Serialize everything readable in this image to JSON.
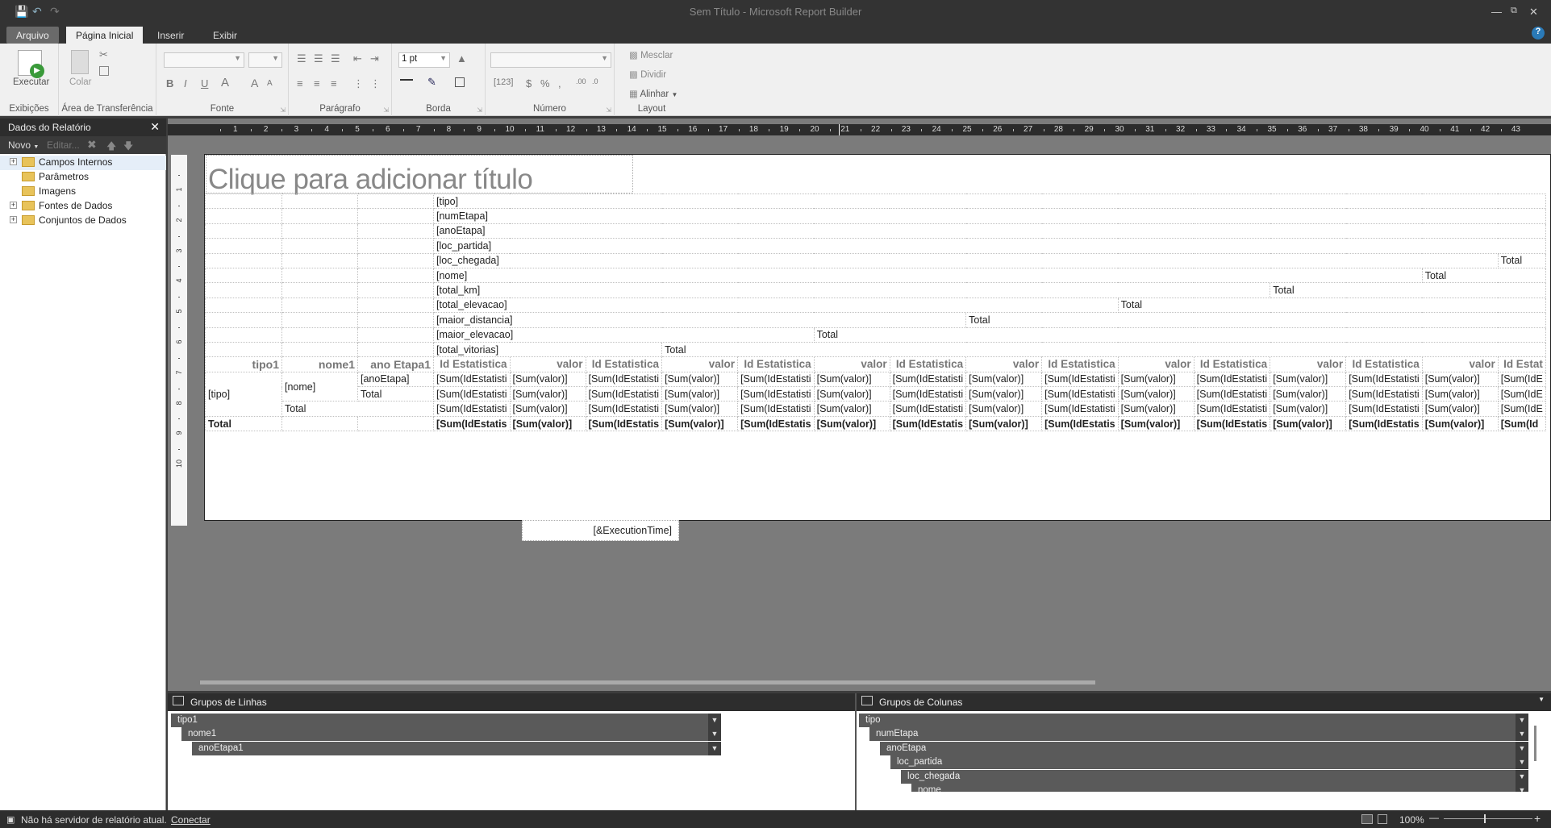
{
  "window": {
    "title": "Sem Título - Microsoft Report Builder"
  },
  "tabs": [
    {
      "label": "Arquivo"
    },
    {
      "label": "Página Inicial"
    },
    {
      "label": "Inserir"
    },
    {
      "label": "Exibir"
    }
  ],
  "ribbon": {
    "groups": {
      "exibicoes": "Exibições",
      "transferencia": "Área de Transferência",
      "fonte": "Fonte",
      "paragrafo": "Parágrafo",
      "borda": "Borda",
      "numero": "Número",
      "layout": "Layout"
    },
    "executar": "Executar",
    "colar": "Colar",
    "border_width": "1 pt",
    "mesclar": "Mesclar",
    "dividir": "Dividir",
    "alinhar": "Alinhar"
  },
  "left_panel": {
    "title": "Dados do Relatório",
    "novo": "Novo",
    "editar": "Editar...",
    "items": [
      {
        "label": "Campos Internos"
      },
      {
        "label": "Parâmetros"
      },
      {
        "label": "Imagens"
      },
      {
        "label": "Fontes de Dados"
      },
      {
        "label": "Conjuntos de Dados"
      }
    ]
  },
  "report": {
    "title_placeholder": "Clique para adicionar título",
    "exec_time": "[&ExecutionTime]",
    "ruler_numbers": [
      "1",
      "2",
      "3",
      "4",
      "5",
      "6",
      "7",
      "8",
      "9",
      "10",
      "11",
      "12",
      "13",
      "14",
      "15",
      "16",
      "17",
      "18",
      "19",
      "20",
      "21",
      "22",
      "23",
      "24",
      "25",
      "26",
      "27",
      "28",
      "29",
      "30",
      "31",
      "32",
      "33",
      "34",
      "35",
      "36",
      "37",
      "38",
      "39",
      "40",
      "41",
      "42",
      "43"
    ],
    "vruler_numbers": [
      "1",
      "2",
      "3",
      "4",
      "5",
      "6",
      "7",
      "8",
      "9",
      "10"
    ],
    "col_groups": [
      "[tipo]",
      "[numEtapa]",
      "[anoEtapa]",
      "[loc_partida]",
      "[loc_chegada]",
      "[nome]",
      "[total_km]",
      "[total_elevacao]",
      "[maior_distancia]",
      "[maior_elevacao]",
      "[total_vitorias]"
    ],
    "total": "Total",
    "row_headers": [
      "tipo1",
      "nome1",
      "ano Etapa1"
    ],
    "col_header_id": "Id Estatistica",
    "col_header_val": "valor",
    "cell_tipo": "[tipo]",
    "cell_nome": "[nome]",
    "cell_ano": "[anoEtapa]",
    "sum_id": "[Sum(IdEstatisti",
    "sum_val": "[Sum(valor)]",
    "sum_id_bold": "[Sum(IdEstatis",
    "sum_val_bold": "[Sum(valor)]",
    "last_col_id_trunc": "Id Estat",
    "last_sum_trunc": "[Sum(IdE",
    "last_sum_bold_trunc": "[Sum(Id"
  },
  "row_groups": {
    "title": "Grupos de Linhas",
    "items": [
      "tipo1",
      "nome1",
      "anoEtapa1"
    ]
  },
  "col_groups_panel": {
    "title": "Grupos de Colunas",
    "items": [
      "tipo",
      "numEtapa",
      "anoEtapa",
      "loc_partida",
      "loc_chegada",
      "nome"
    ]
  },
  "status": {
    "server": "Não há servidor de relatório atual.",
    "connect": "Conectar",
    "zoom": "100%"
  }
}
